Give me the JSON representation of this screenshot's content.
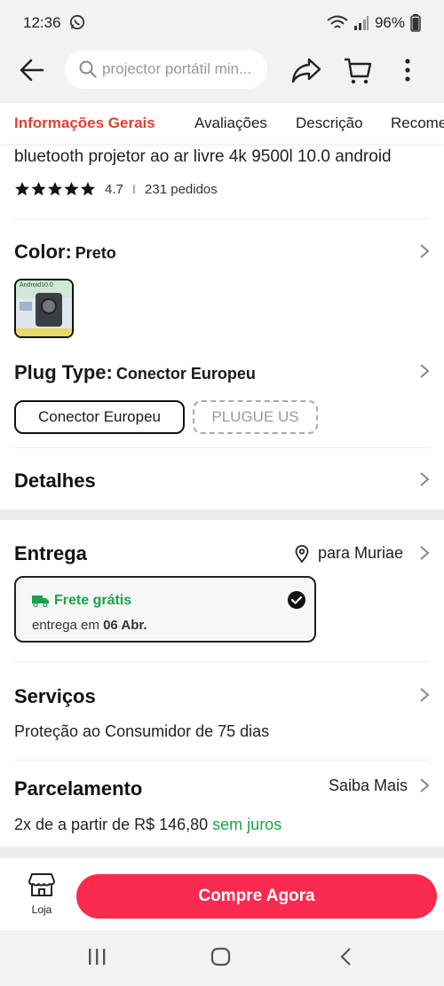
{
  "status_bar": {
    "time": "12:36",
    "battery": "96%"
  },
  "search": {
    "placeholder": "projector portátil min..."
  },
  "tabs": [
    {
      "label": "Informações Gerais",
      "active": true
    },
    {
      "label": "Avaliações"
    },
    {
      "label": "Descrição"
    },
    {
      "label": "Recome"
    }
  ],
  "product": {
    "title_tail": "bluetooth projetor ao ar livre 4k 9500l 10.0 android",
    "rating": "4.7",
    "separator": "I",
    "orders": "231 pedidos"
  },
  "color": {
    "label": "Color:",
    "value": "Preto",
    "thumb_text": "Android10.0"
  },
  "plug_type": {
    "label": "Plug Type:",
    "value": "Conector Europeu",
    "options": [
      "Conector Europeu",
      "PLUGUE US"
    ]
  },
  "details": {
    "label": "Detalhes"
  },
  "delivery": {
    "title": "Entrega",
    "location": "para Muriae",
    "shipping": "Frete grátis",
    "eta_prefix": "entrega em",
    "eta_date": "06 Abr."
  },
  "services": {
    "title": "Serviços",
    "text": "Proteção ao Consumidor de 75 dias"
  },
  "installments": {
    "title": "Parcelamento",
    "link": "Saiba Mais",
    "text": "2x de a partir de R$ 146,80",
    "highlight": "sem juros"
  },
  "bottom": {
    "store_label": "Loja",
    "buy_label": "Compre Agora"
  },
  "colors": {
    "accent": "#e2412f",
    "buy": "#fa2b4e",
    "green": "#1aa34a"
  }
}
